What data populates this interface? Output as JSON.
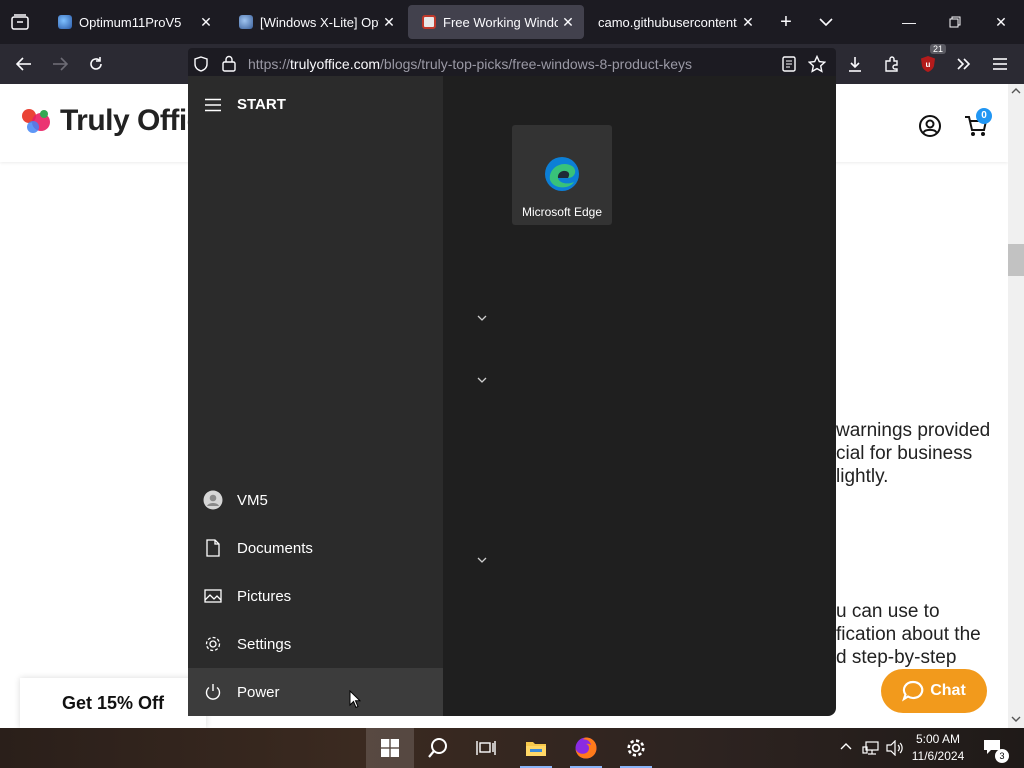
{
  "browser": {
    "tabs": [
      {
        "title": "Optimum11ProV5",
        "active": false
      },
      {
        "title": "[Windows X-Lite] Optim",
        "active": false
      },
      {
        "title": "Free Working Windows",
        "active": true
      },
      {
        "title": "camo.githubusercontent.co",
        "active": false
      }
    ],
    "url_host": "trulyoffice.com",
    "url_path": "/blogs/truly-top-picks/free-windows-8-product-keys",
    "extension_badge": "21"
  },
  "site": {
    "logo_text": "Truly Office",
    "cart_count": "0",
    "para1": [
      "warnings provided",
      "cial for business",
      "lightly."
    ],
    "para2": [
      "u can use to",
      "fication about the",
      "d step-by-step"
    ],
    "promo": "Get 15% Off",
    "chat": "Chat"
  },
  "start_menu": {
    "title": "START",
    "items": [
      {
        "label": "VM5",
        "icon": "user-icon"
      },
      {
        "label": "Documents",
        "icon": "document-icon"
      },
      {
        "label": "Pictures",
        "icon": "pictures-icon"
      },
      {
        "label": "Settings",
        "icon": "gear-icon"
      },
      {
        "label": "Power",
        "icon": "power-icon"
      }
    ],
    "tile": {
      "label": "Microsoft Edge"
    }
  },
  "taskbar": {
    "time": "5:00 AM",
    "date": "11/6/2024",
    "notifications": "3"
  },
  "colors": {
    "accent": "#f29a1c",
    "browser_bg": "#1c1b22",
    "start_bg": "#1f1f1f"
  }
}
